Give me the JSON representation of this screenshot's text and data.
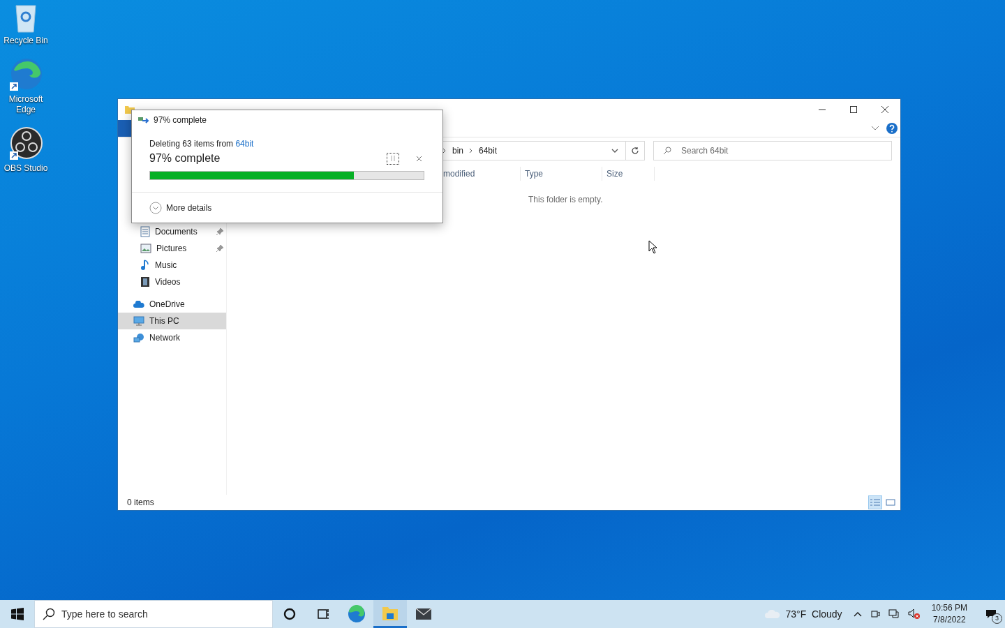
{
  "desktop_icons": [
    {
      "label": "Recycle Bin",
      "kind": "bin"
    },
    {
      "label": "Microsoft Edge",
      "kind": "edge"
    },
    {
      "label": "OBS Studio",
      "kind": "obs"
    }
  ],
  "explorer": {
    "address": [
      "bin",
      "64bit"
    ],
    "search": {
      "placeholder": "Search 64bit"
    },
    "columns": [
      "modified",
      "Type",
      "Size"
    ],
    "empty_message": "This folder is empty.",
    "quick_access_items": [
      {
        "label": "Documents",
        "kind": "documents",
        "pinned": true
      },
      {
        "label": "Pictures",
        "kind": "pictures",
        "pinned": true
      },
      {
        "label": "Music",
        "kind": "music",
        "pinned": false
      },
      {
        "label": "Videos",
        "kind": "videos",
        "pinned": false
      }
    ],
    "locations": [
      {
        "label": "OneDrive",
        "kind": "cloud",
        "selected": false
      },
      {
        "label": "This PC",
        "kind": "pc",
        "selected": true
      },
      {
        "label": "Network",
        "kind": "network",
        "selected": false
      }
    ],
    "status": "0 items"
  },
  "progress_dialog": {
    "title": "97% complete",
    "message_prefix": "Deleting 63 items from",
    "source_link": "64bit",
    "heading": "97% complete",
    "level": 0.745,
    "more_details": "More details"
  },
  "taskbar": {
    "search": {
      "placeholder": "Type here to search"
    },
    "apps": [
      {
        "kind": "cortana",
        "active": false
      },
      {
        "kind": "taskview",
        "active": false
      },
      {
        "kind": "edge",
        "active": false
      },
      {
        "kind": "explorer",
        "active": true
      },
      {
        "kind": "mail",
        "active": false
      }
    ],
    "weather": "73°F  Cloudy",
    "time": "10:56 PM",
    "date": "7/8/2022",
    "notification_count": "3"
  }
}
